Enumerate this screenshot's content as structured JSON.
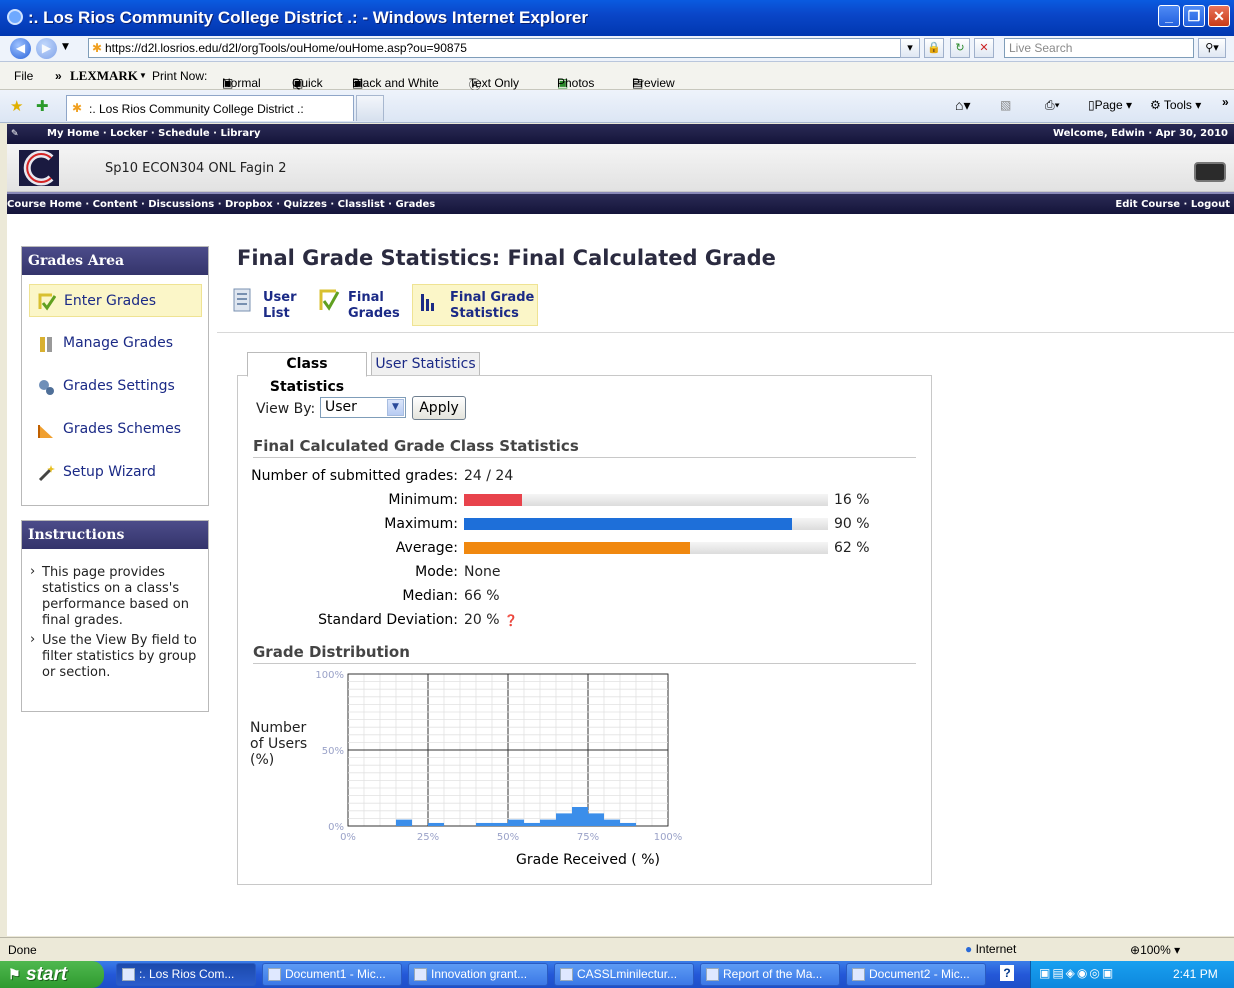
{
  "window": {
    "title": ":. Los Rios Community College District .: - Windows Internet Explorer",
    "url": "https://d2l.losrios.edu/d2l/orgTools/ouHome/ouHome.asp?ou=90875",
    "search_placeholder": "Live Search"
  },
  "menubar": {
    "file": "File",
    "chevron": "»",
    "brand": "LEXMARK",
    "print_now": "Print Now:",
    "normal": "Normal",
    "quick": "Quick",
    "bw": "Black and White",
    "text_only": "Text Only",
    "photos": "Photos",
    "preview": "Preview"
  },
  "tabbar": {
    "tab_label": ":. Los Rios Community College District .:",
    "page": "Page",
    "tools": "Tools"
  },
  "topnav": {
    "links": "My Home · Locker · Schedule · Library",
    "welcome": "Welcome, Edwin · Apr 30, 2010"
  },
  "course": {
    "name": "Sp10 ECON304 ONL Fagin 2"
  },
  "coursenav": {
    "links": "Course Home · Content · Discussions · Dropbox · Quizzes · Classlist · Grades",
    "right": "Edit Course · Logout"
  },
  "grades_area": {
    "title": "Grades Area",
    "items": [
      "Enter Grades",
      "Manage Grades",
      "Grades Settings",
      "Grades Schemes",
      "Setup Wizard"
    ]
  },
  "instructions": {
    "title": "Instructions",
    "items": [
      "This page provides statistics on a class's performance based on final grades.",
      "Use the View By field to filter statistics by group or section."
    ]
  },
  "page": {
    "title": "Final Grade Statistics: Final Calculated Grade",
    "subnav_user_list": [
      "User",
      "List"
    ],
    "subnav_final_grades": [
      "Final",
      "Grades"
    ],
    "subnav_statistics": [
      "Final Grade",
      "Statistics"
    ]
  },
  "tabs": {
    "class_stats": "Class Statistics",
    "user_stats": "User Statistics"
  },
  "viewby": {
    "label": "View By:",
    "selected": "User",
    "apply": "Apply"
  },
  "stats": {
    "heading": "Final Calculated Grade Class Statistics",
    "submitted_label": "Number of submitted grades:",
    "submitted_value": "24 / 24",
    "minimum_label": "Minimum:",
    "minimum_value": "16 %",
    "minimum_fraction": 0.16,
    "maximum_label": "Maximum:",
    "maximum_value": "90 %",
    "maximum_fraction": 0.9,
    "average_label": "Average:",
    "average_value": "62 %",
    "average_fraction": 0.62,
    "mode_label": "Mode:",
    "mode_value": "None",
    "median_label": "Median:",
    "median_value": "66 %",
    "std_label": "Standard Deviation:",
    "std_value": "20 %",
    "bar_colors": {
      "minimum": "#e8434c",
      "maximum": "#1e6fd9",
      "average": "#f0880f"
    }
  },
  "chart_data": {
    "type": "bar",
    "title": "Grade Distribution",
    "xlabel": "Grade Received ( %)",
    "ylabel": "Number of Users (%)",
    "xlim": [
      0,
      100
    ],
    "ylim": [
      0,
      100
    ],
    "x_ticks": [
      "0%",
      "25%",
      "50%",
      "75%",
      "100%"
    ],
    "y_ticks": [
      "0%",
      "50%",
      "100%"
    ],
    "bin_width": 5,
    "bins": [
      {
        "x": 15,
        "y": 4.2
      },
      {
        "x": 25,
        "y": 2.0
      },
      {
        "x": 40,
        "y": 2.0
      },
      {
        "x": 45,
        "y": 2.0
      },
      {
        "x": 50,
        "y": 4.2
      },
      {
        "x": 55,
        "y": 2.0
      },
      {
        "x": 60,
        "y": 4.2
      },
      {
        "x": 65,
        "y": 8.3
      },
      {
        "x": 70,
        "y": 12.5
      },
      {
        "x": 75,
        "y": 8.3
      },
      {
        "x": 80,
        "y": 4.2
      },
      {
        "x": 85,
        "y": 2.0
      }
    ],
    "color": "#3b8eea",
    "grid": true
  },
  "status": {
    "left": "Done",
    "zone": "Internet",
    "zoom": "100%"
  },
  "taskbar": {
    "start": "start",
    "items": [
      ":. Los Rios Com...",
      "Document1 - Mic...",
      "Innovation grant...",
      "CASSLminilectur...",
      "Report of the Ma...",
      "Document2 - Mic..."
    ],
    "clock": "2:41 PM"
  }
}
